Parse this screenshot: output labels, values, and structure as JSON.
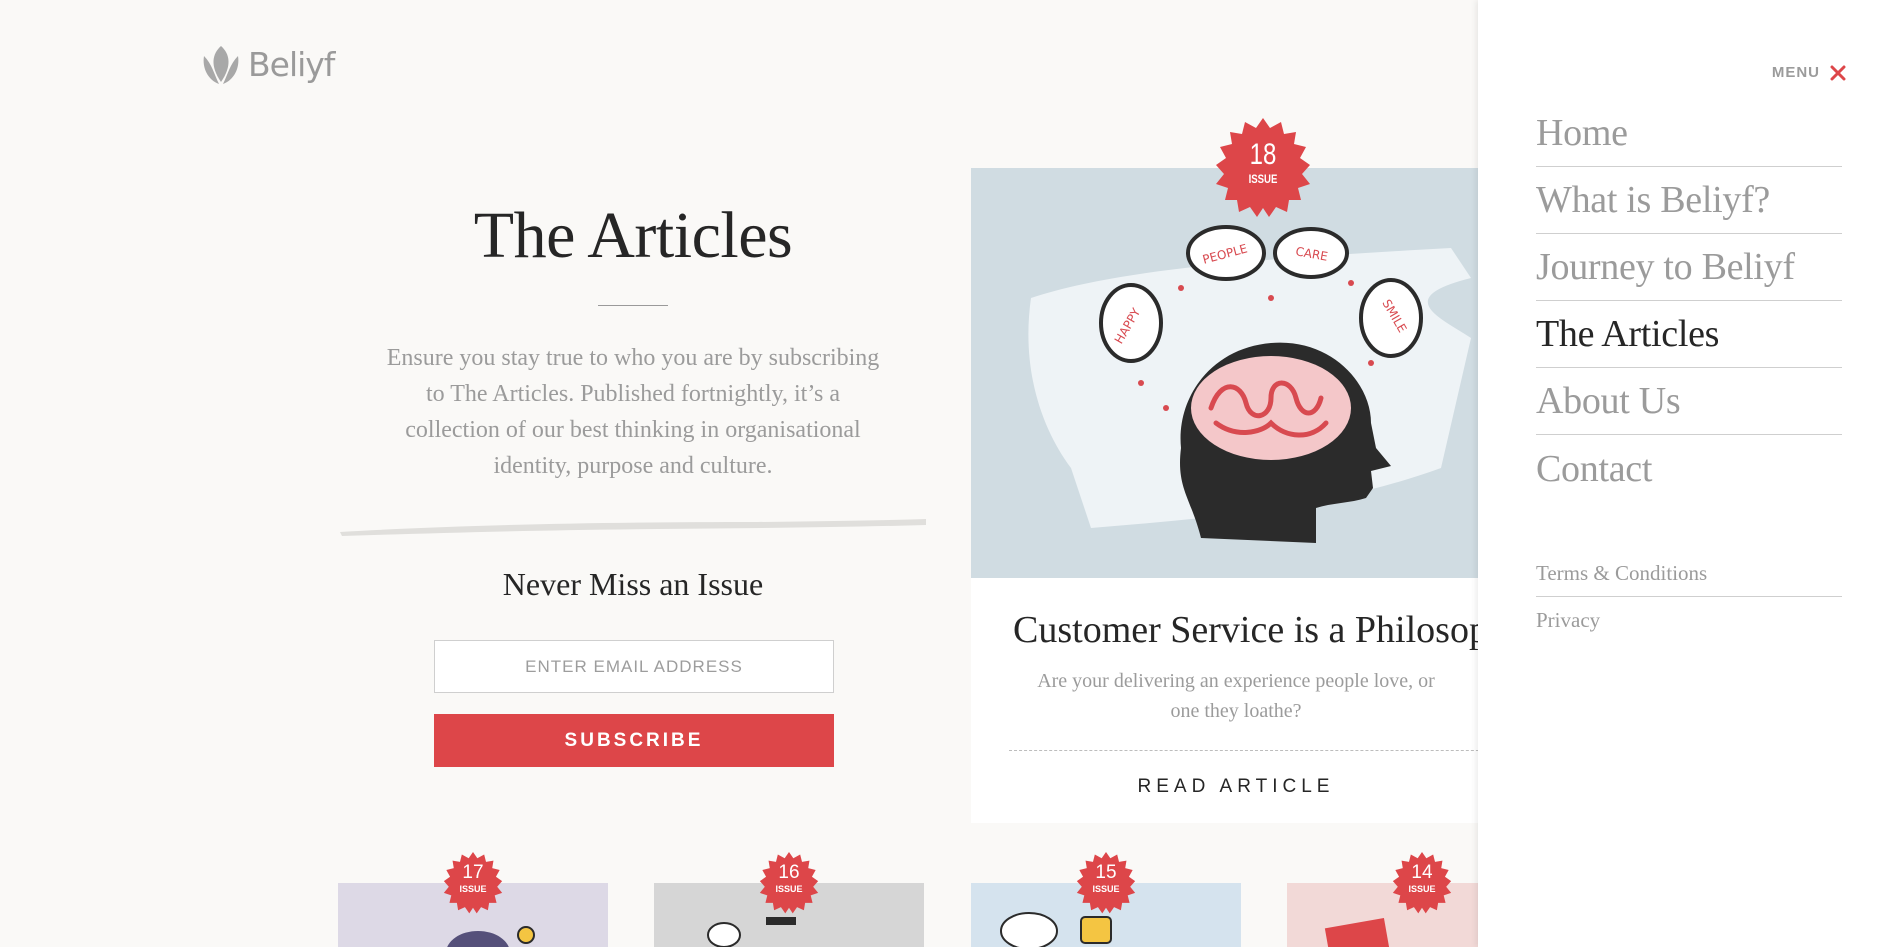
{
  "brand": {
    "name": "Beliyf"
  },
  "intro": {
    "title": "The Articles",
    "description": "Ensure you stay true to who you are by subscribing to The Articles. Published fortnightly, it’s a collection of our best thinking in organisational identity, purpose and culture.",
    "signup_heading": "Never Miss an Issue",
    "email_placeholder": "ENTER EMAIL ADDRESS",
    "subscribe_label": "SUBSCRIBE"
  },
  "featured": {
    "issue_number": "18",
    "issue_label": "ISSUE",
    "illustration_words": [
      "HAPPY",
      "PEOPLE",
      "CARE",
      "SMILE"
    ],
    "title": "Customer Service is a Philosophy",
    "summary": "Are your delivering an experience people love, or one they loathe?",
    "cta": "READ ARTICLE"
  },
  "issues": [
    {
      "number": "17",
      "label": "ISSUE",
      "bg": "#ddd9e6"
    },
    {
      "number": "16",
      "label": "ISSUE",
      "bg": "#d6d6d6"
    },
    {
      "number": "15",
      "label": "ISSUE",
      "bg": "#d5e3ee"
    },
    {
      "number": "14",
      "label": "ISSUE",
      "bg": "#f2d9d7"
    }
  ],
  "menu": {
    "toggle_label": "MENU",
    "items": [
      {
        "label": "Home",
        "active": false
      },
      {
        "label": "What is Beliyf?",
        "active": false
      },
      {
        "label": "Journey to Beliyf",
        "active": false
      },
      {
        "label": "The Articles",
        "active": true
      },
      {
        "label": "About Us",
        "active": false
      },
      {
        "label": "Contact",
        "active": false
      }
    ],
    "legal": [
      {
        "label": "Terms & Conditions"
      },
      {
        "label": "Privacy"
      }
    ]
  },
  "colors": {
    "accent": "#dd4649",
    "text": "#262626",
    "muted": "#9b9b9b",
    "background": "#faf9f7"
  },
  "icons": {
    "logo": "leaf-icon",
    "close": "close-icon"
  }
}
